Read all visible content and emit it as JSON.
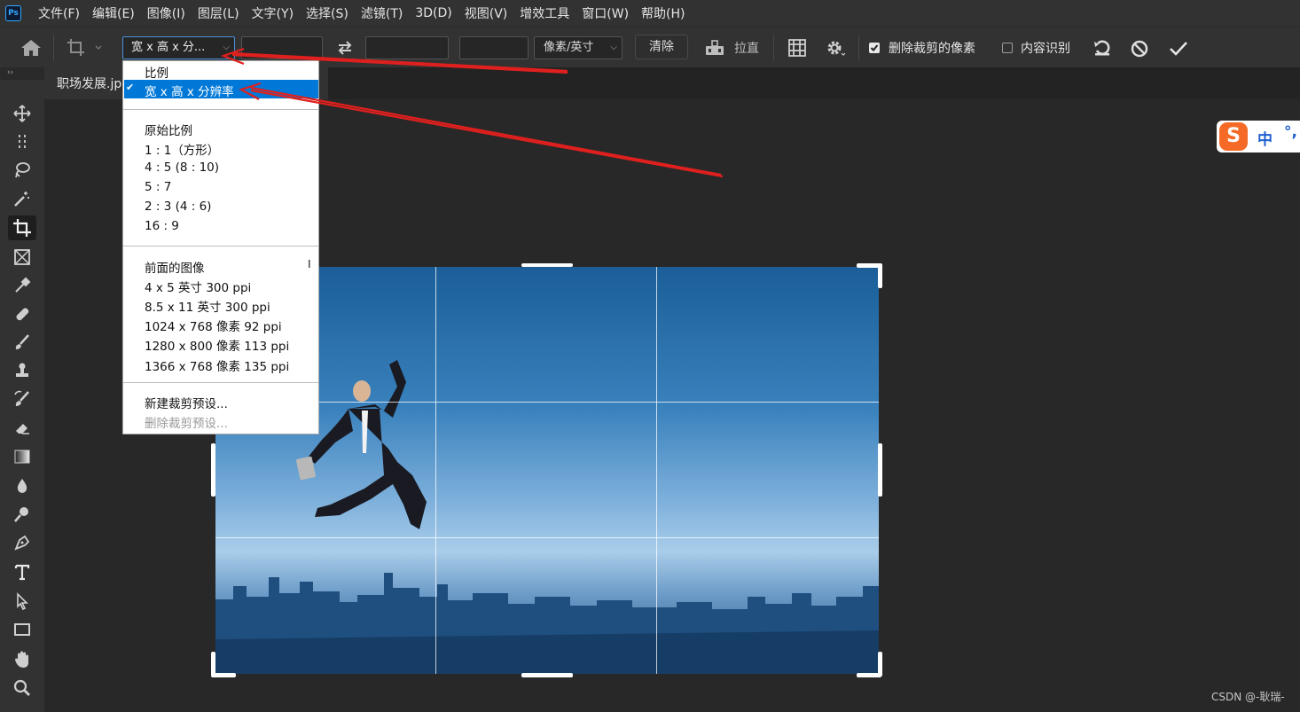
{
  "app": {
    "logo_text": "Ps"
  },
  "menu": [
    "文件(F)",
    "编辑(E)",
    "图像(I)",
    "图层(L)",
    "文字(Y)",
    "选择(S)",
    "滤镜(T)",
    "3D(D)",
    "视图(V)",
    "增效工具",
    "窗口(W)",
    "帮助(H)"
  ],
  "options": {
    "preset_value": "宽 x 高 x 分...",
    "unit_value": "像素/英寸",
    "clear_label": "清除",
    "straighten_label": "拉直",
    "delete_cropped_label": "删除裁剪的像素",
    "delete_cropped_checked": true,
    "content_aware_label": "内容识别",
    "content_aware_checked": false
  },
  "document": {
    "tab_title": "职场发展.jp"
  },
  "dropdown": {
    "items": [
      "比例",
      "宽 x 高 x 分辨率",
      "原始比例",
      "1 : 1（方形）",
      "4 : 5 (8 : 10)",
      "5 : 7",
      "2 : 3 (4 : 6)",
      "16 : 9",
      "前面的图像",
      "4 x 5 英寸 300 ppi",
      "8.5 x 11 英寸 300 ppi",
      "1024 x 768 像素 92 ppi",
      "1280 x 800 像素 113 ppi",
      "1366 x 768 像素 135 ppi",
      "新建裁剪预设...",
      "删除裁剪预设..."
    ],
    "selected_index": 1,
    "check_mark": "✔",
    "cursor_glyph": "I"
  },
  "ime": {
    "logo": "S",
    "mode": "中",
    "punct": "°,"
  },
  "watermark": "CSDN @-耿瑞-",
  "colors": {
    "selection": "#0078d7",
    "arrow": "#e0201e",
    "ime": "#f46a26"
  }
}
